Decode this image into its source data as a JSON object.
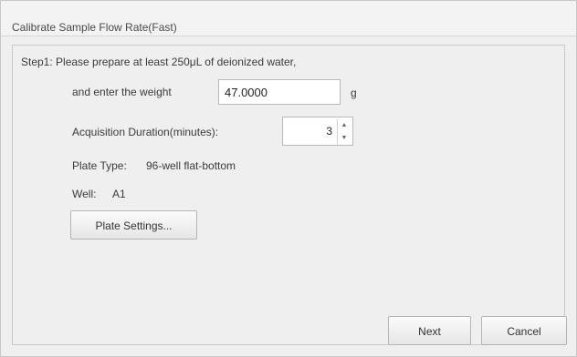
{
  "dialog": {
    "title": "Calibrate Sample Flow Rate(Fast)"
  },
  "step": {
    "instruction": "Step1: Please prepare at least 250μL of deionized water,",
    "weight_label": "and enter the weight",
    "weight_value": "47.0000",
    "weight_unit": "g",
    "duration_label": "Acquisition Duration(minutes):",
    "duration_value": "3",
    "plate_type_label": "Plate Type:",
    "plate_type_value": "96-well flat-bottom",
    "well_label": "Well:",
    "well_value": "A1",
    "plate_settings_button": "Plate Settings..."
  },
  "footer": {
    "next_button": "Next",
    "cancel_button": "Cancel"
  }
}
